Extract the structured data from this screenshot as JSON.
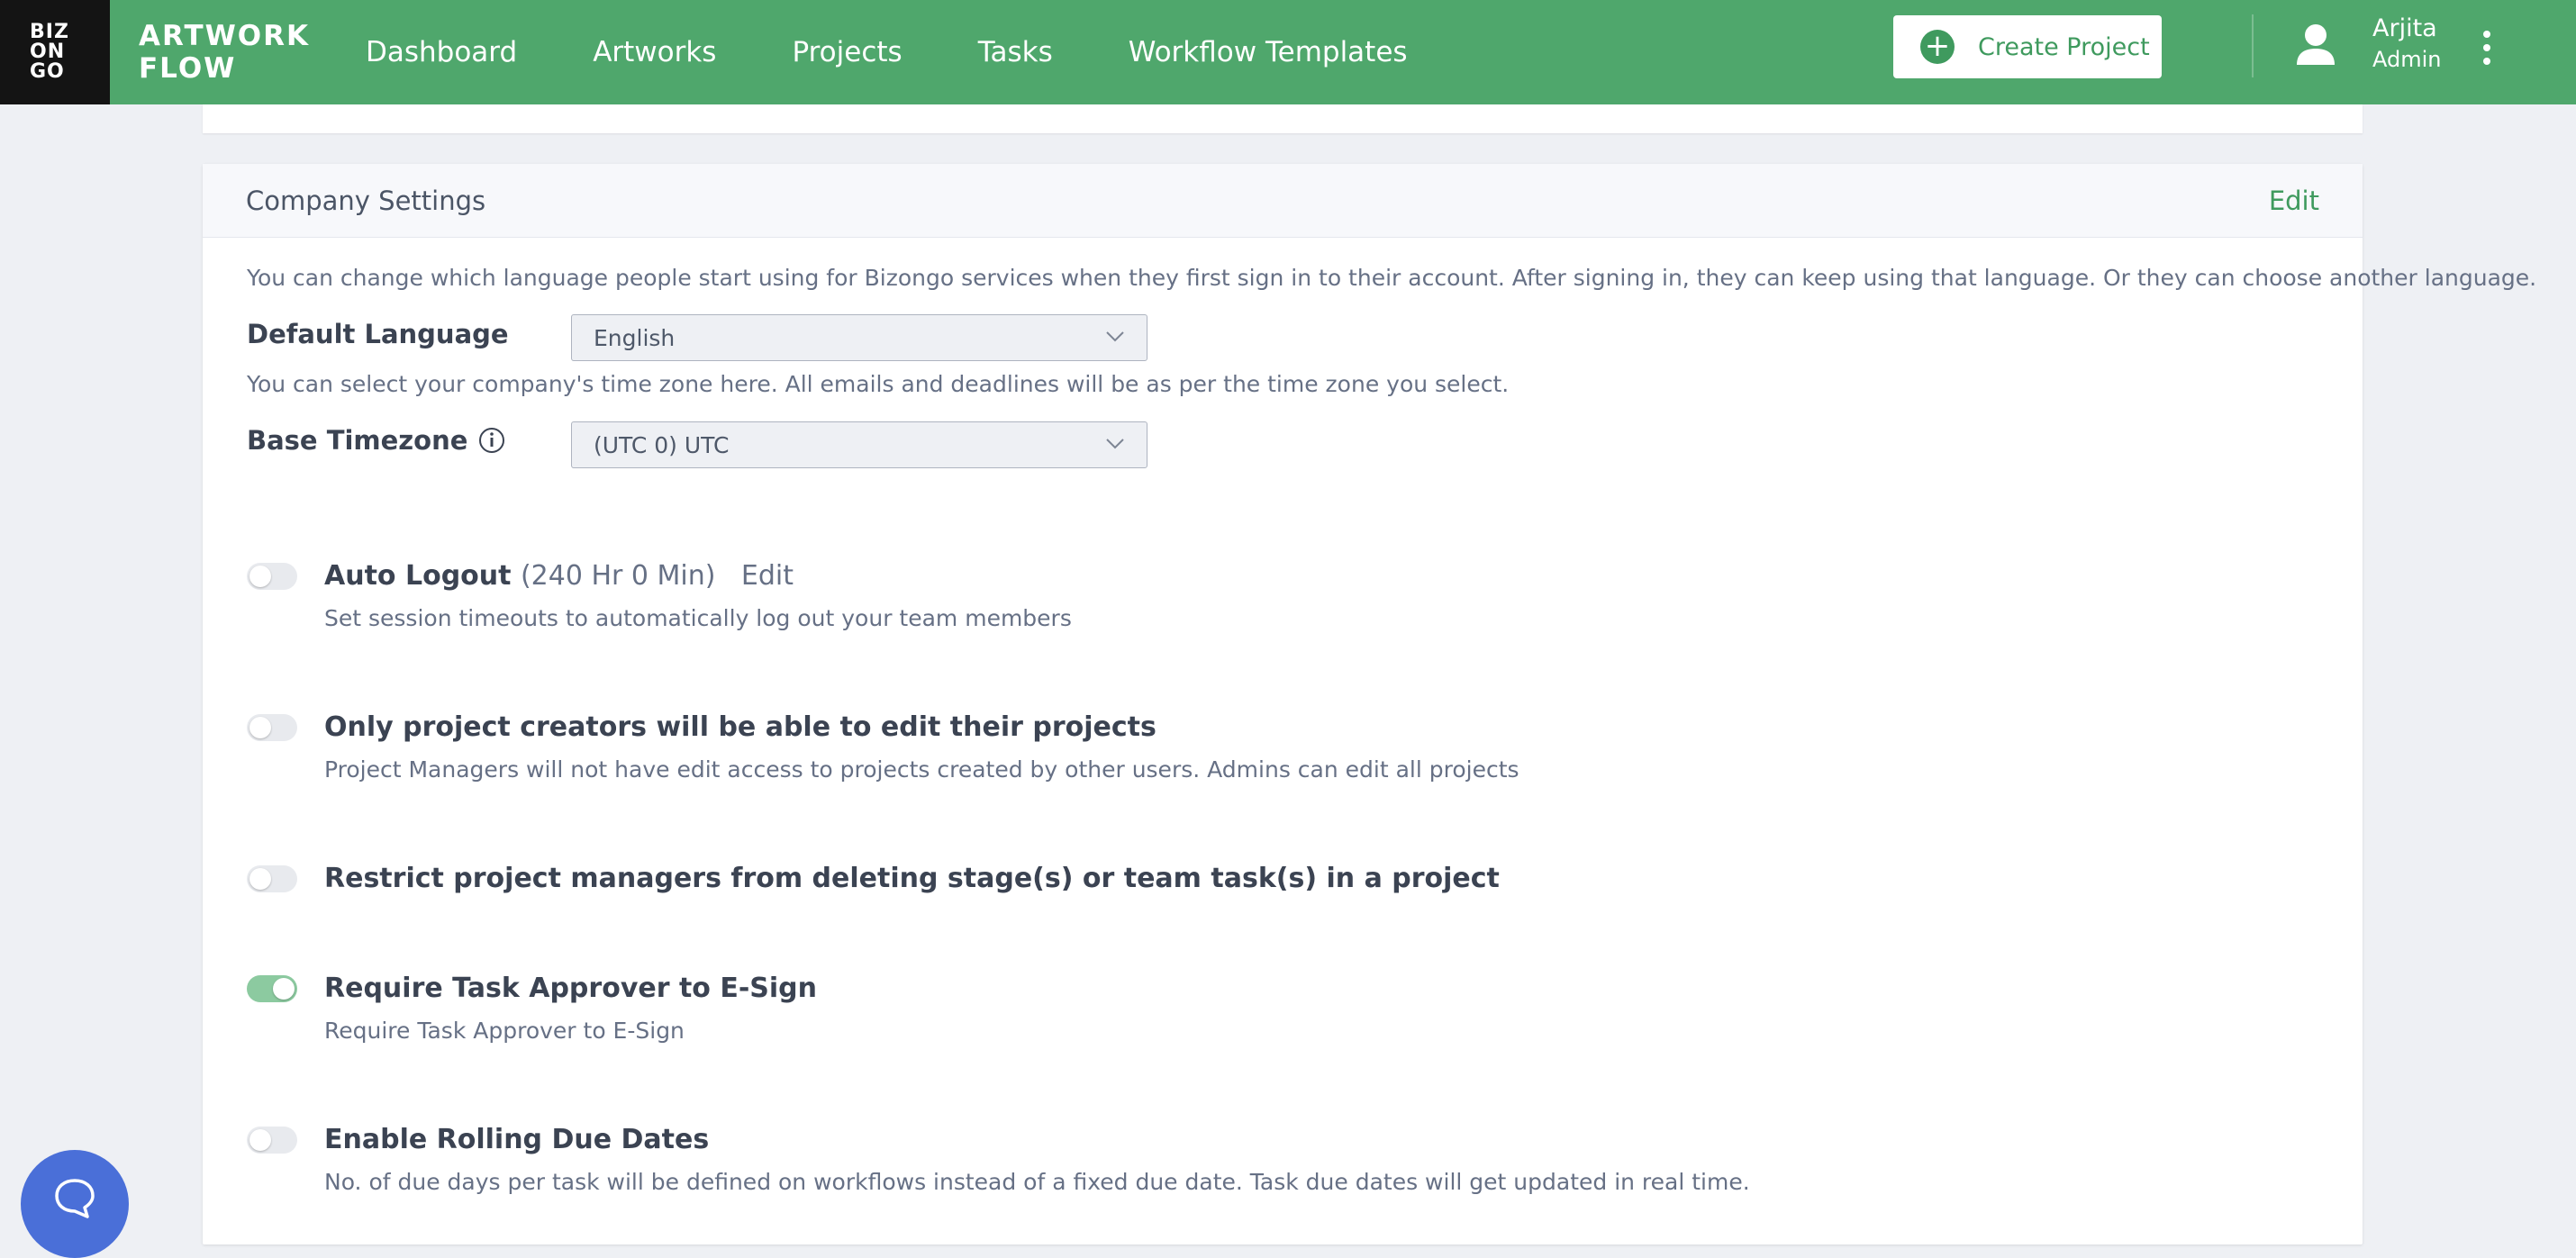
{
  "logo": {
    "text": "BIZ\nON\nGO",
    "icon": "bizongo-logo"
  },
  "brand": {
    "line1": "ARTWORK",
    "line2": "FLOW"
  },
  "nav": {
    "items": [
      {
        "label": "Dashboard"
      },
      {
        "label": "Artworks"
      },
      {
        "label": "Projects"
      },
      {
        "label": "Tasks"
      },
      {
        "label": "Workflow Templates"
      }
    ]
  },
  "create_project": {
    "label": "Create Project",
    "icon": "plus-circle-icon"
  },
  "user": {
    "name": "Arjita",
    "role": "Admin",
    "icon": "user-icon"
  },
  "company_settings": {
    "title": "Company Settings",
    "edit_label": "Edit",
    "language_help": "You can change which language people start using for Bizongo services when they first sign in to their account. After signing in, they can keep using that language. Or they can choose another language.",
    "language_label": "Default Language",
    "language_value": "English",
    "timezone_help": "You can select your company's time zone here. All emails and deadlines will be as per the time zone you select.",
    "timezone_label": "Base Timezone",
    "timezone_value": "(UTC 0) UTC"
  },
  "settings": [
    {
      "title": "Auto Logout",
      "extra": "(240 Hr 0 Min)",
      "edit": "Edit",
      "description": "Set session timeouts to automatically log out your team members",
      "enabled": false
    },
    {
      "title": "Only project creators will be able to edit their projects",
      "description": "Project Managers will not have edit access to projects created by other users. Admins can edit all projects",
      "enabled": false
    },
    {
      "title": "Restrict project managers from deleting stage(s) or team task(s) in a project",
      "enabled": false
    },
    {
      "title": "Require Task Approver to E-Sign",
      "description": "Require Task Approver to E-Sign",
      "enabled": true
    },
    {
      "title": "Enable Rolling Due Dates",
      "description": "No. of due days per task will be defined on workflows instead of a fixed due date. Task due dates will get updated in real time.",
      "enabled": false
    }
  ],
  "colors": {
    "brand_green": "#4fa76c",
    "accent_green": "#3f9a5e",
    "toggle_on": "#8ccaa0",
    "chat_blue": "#4a6fd8"
  }
}
